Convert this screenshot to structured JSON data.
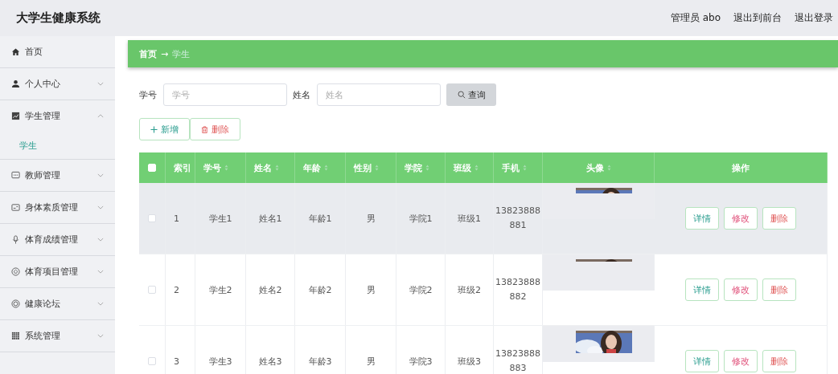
{
  "header": {
    "title": "大学生健康系统",
    "user": "管理员 abo",
    "links": [
      "退出到前台",
      "退出登录"
    ]
  },
  "sidebar": {
    "items": [
      {
        "label": "首页"
      },
      {
        "label": "个人中心",
        "expanded": false
      },
      {
        "label": "学生管理",
        "expanded": true,
        "children": [
          {
            "label": "学生",
            "selected": true
          }
        ]
      },
      {
        "label": "教师管理",
        "expanded": false
      },
      {
        "label": "身体素质管理",
        "expanded": false
      },
      {
        "label": "体育成绩管理",
        "expanded": false
      },
      {
        "label": "体育项目管理",
        "expanded": false
      },
      {
        "label": "健康论坛",
        "expanded": false
      },
      {
        "label": "系统管理",
        "expanded": false
      }
    ]
  },
  "breadcrumb": {
    "home": "首页",
    "separator": "→",
    "current": "学生"
  },
  "search": {
    "fields": [
      {
        "label": "学号",
        "placeholder": "学号"
      },
      {
        "label": "姓名",
        "placeholder": "姓名"
      }
    ],
    "button": "查询"
  },
  "actions": {
    "add": "新增",
    "delete": "删除"
  },
  "table": {
    "select_all_checked": false,
    "columns": [
      {
        "label": "索引"
      },
      {
        "label": "学号",
        "sortable": true
      },
      {
        "label": "姓名",
        "sortable": true
      },
      {
        "label": "年龄",
        "sortable": true
      },
      {
        "label": "性别",
        "sortable": true
      },
      {
        "label": "学院",
        "sortable": true
      },
      {
        "label": "班级",
        "sortable": true
      },
      {
        "label": "手机",
        "sortable": true
      },
      {
        "label": "头像",
        "sortable": true
      },
      {
        "label": "操作"
      }
    ],
    "rows": [
      {
        "checked": false,
        "highlighted": true,
        "index": "1",
        "student_id": "学生1",
        "name": "姓名1",
        "age": "年龄1",
        "gender": "男",
        "college": "学院1",
        "class": "班级1",
        "phone": [
          "13823888",
          "881"
        ],
        "avatar": {
          "kind": "picture"
        },
        "buttons": [
          "详情",
          "修改",
          "删除"
        ]
      },
      {
        "checked": false,
        "highlighted": false,
        "index": "2",
        "student_id": "学生2",
        "name": "姓名2",
        "age": "年龄2",
        "gender": "男",
        "college": "学院2",
        "class": "班级2",
        "phone": [
          "13823888",
          "882"
        ],
        "avatar": {
          "kind": "picture"
        },
        "buttons": [
          "详情",
          "修改",
          "删除"
        ]
      },
      {
        "checked": false,
        "highlighted": false,
        "index": "3",
        "student_id": "学生3",
        "name": "姓名3",
        "age": "年龄3",
        "gender": "男",
        "college": "学院3",
        "class": "班级3",
        "phone": [
          "13823888",
          "883"
        ],
        "avatar": {
          "kind": "picture"
        },
        "buttons": [
          "详情",
          "修改",
          "删除"
        ]
      }
    ]
  }
}
